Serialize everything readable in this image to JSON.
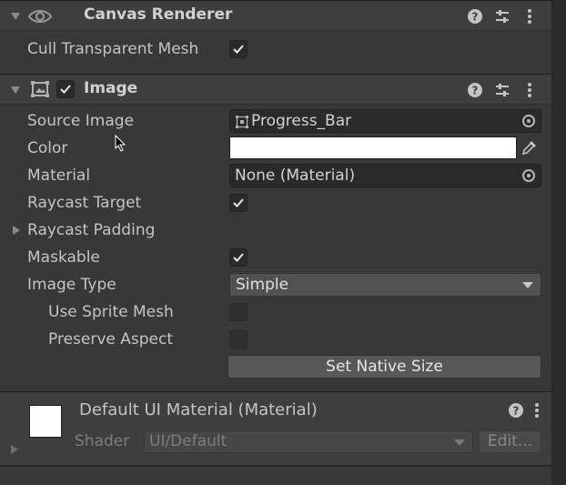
{
  "canvas_renderer": {
    "title": "Canvas Renderer",
    "cull_transparent_mesh": {
      "label": "Cull Transparent Mesh",
      "checked": true
    }
  },
  "image": {
    "title": "Image",
    "enabled": true,
    "source_image": {
      "label": "Source Image",
      "value": "Progress_Bar"
    },
    "color": {
      "label": "Color",
      "value": "#ffffff"
    },
    "material": {
      "label": "Material",
      "value": "None (Material)"
    },
    "raycast_target": {
      "label": "Raycast Target",
      "checked": true
    },
    "raycast_padding": {
      "label": "Raycast Padding"
    },
    "maskable": {
      "label": "Maskable",
      "checked": true
    },
    "image_type": {
      "label": "Image Type",
      "value": "Simple"
    },
    "use_sprite_mesh": {
      "label": "Use Sprite Mesh",
      "checked": false
    },
    "preserve_aspect": {
      "label": "Preserve Aspect",
      "checked": false
    },
    "set_native_size": "Set Native Size"
  },
  "material_section": {
    "title": "Default UI Material (Material)",
    "shader_label": "Shader",
    "shader_value": "UI/Default",
    "edit_label": "Edit..."
  },
  "icons": {
    "visibility": "eye-icon",
    "image_component": "image-component-icon",
    "help": "help-icon",
    "presets": "presets-icon",
    "menu": "kebab-menu-icon",
    "sprite": "sprite-icon",
    "object_picker": "object-picker-icon",
    "eyedropper": "eyedropper-icon"
  }
}
